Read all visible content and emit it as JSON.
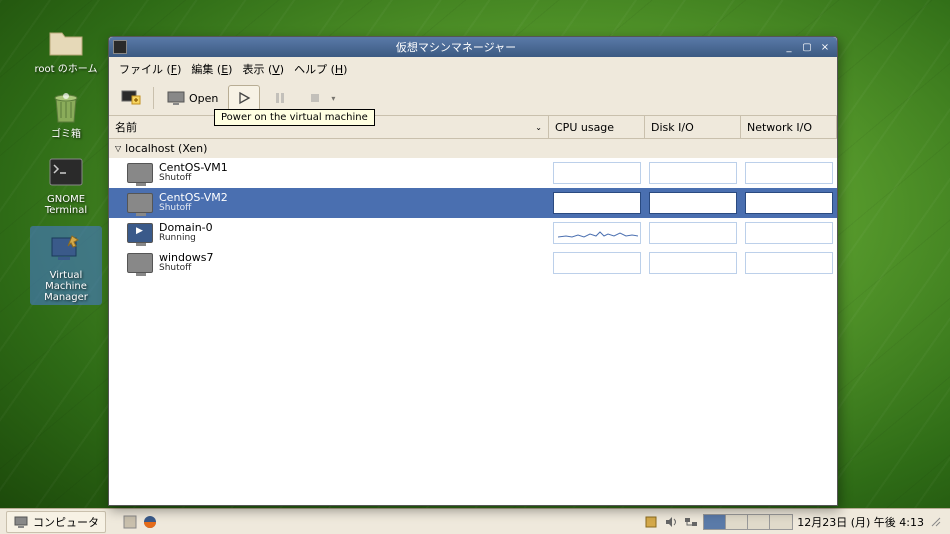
{
  "desktop_icons": [
    {
      "label": "root のホーム",
      "kind": "folder"
    },
    {
      "label": "ゴミ箱",
      "kind": "trash"
    },
    {
      "label": "GNOME Terminal",
      "kind": "terminal"
    },
    {
      "label": "Virtual Machine Manager",
      "kind": "vmm",
      "selected": true
    }
  ],
  "window": {
    "title": "仮想マシンマネージャー",
    "menu": {
      "file": "ファイル",
      "file_u": "F",
      "edit": "編集",
      "edit_u": "E",
      "view": "表示",
      "view_u": "V",
      "help": "ヘルプ",
      "help_u": "H"
    },
    "toolbar": {
      "open_label": "Open",
      "tooltip": "Power on the virtual machine"
    },
    "columns": {
      "name": "名前",
      "cpu": "CPU usage",
      "disk": "Disk I/O",
      "net": "Network I/O"
    },
    "host": "localhost (Xen)",
    "vms": [
      {
        "name": "CentOS-VM1",
        "state": "Shutoff",
        "running": false,
        "selected": false
      },
      {
        "name": "CentOS-VM2",
        "state": "Shutoff",
        "running": false,
        "selected": true
      },
      {
        "name": "Domain-0",
        "state": "Running",
        "running": true,
        "selected": false,
        "cpu_spark": true
      },
      {
        "name": "windows7",
        "state": "Shutoff",
        "running": false,
        "selected": false
      }
    ]
  },
  "taskbar": {
    "computer": "コンピュータ",
    "clock": "12月23日 (月) 午後 4:13"
  }
}
